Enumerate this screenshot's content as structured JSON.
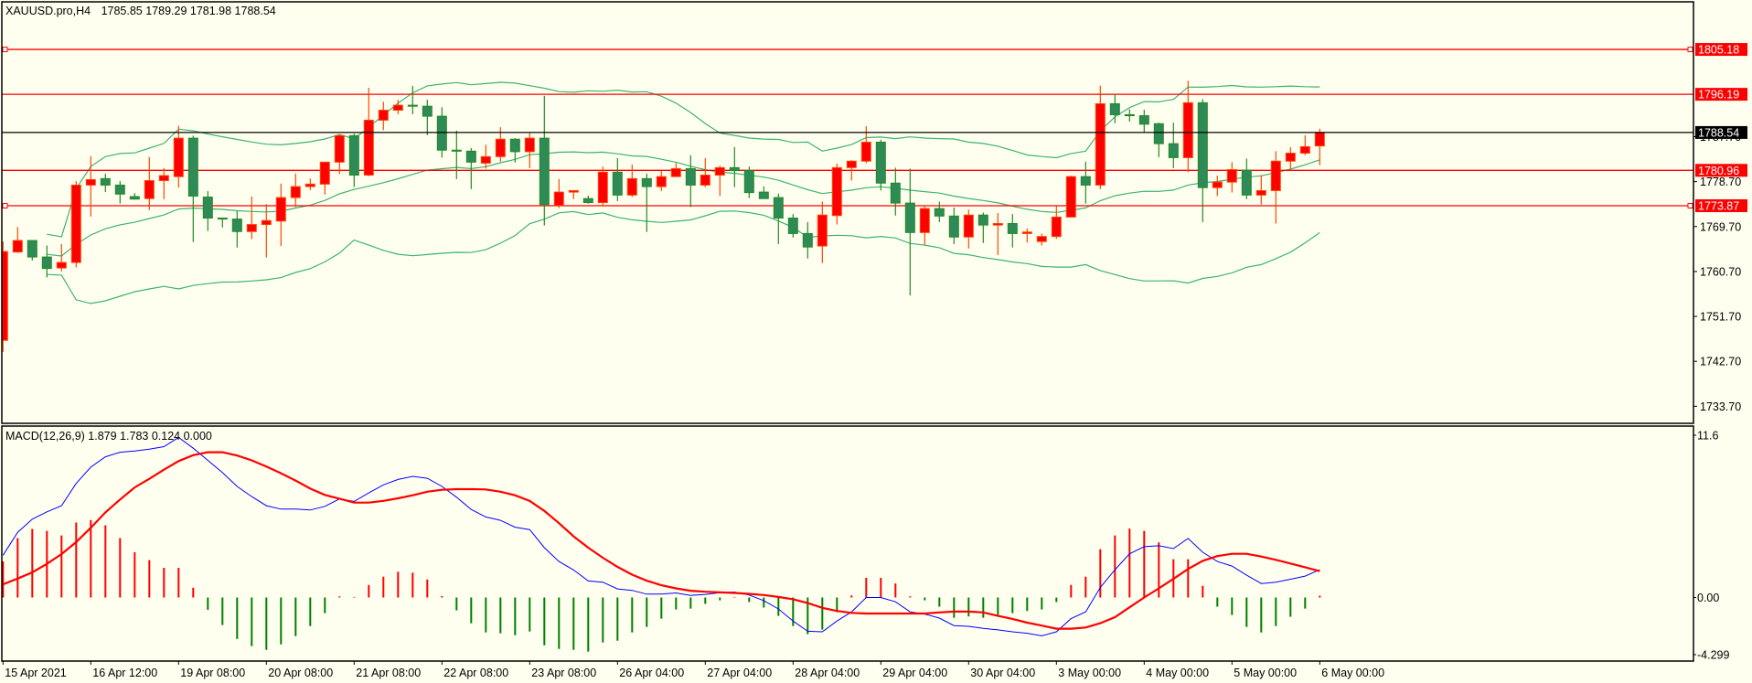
{
  "header": {
    "symbol_timeframe": "XAUUSD.pro,H4",
    "ohlc": "1785.85 1789.29 1781.98 1788.54"
  },
  "colors": {
    "background": "#fffff0",
    "bull": "#ff0000",
    "bull_border": "#ff4500",
    "bear": "#2e8b57",
    "bear_border": "#228b22",
    "bands": "#3cb371",
    "hline": "#ff0000",
    "bid": "#000000",
    "macd": "#0000ff",
    "signal": "#ff0000",
    "hist_up": "#ff0000",
    "hist_down": "#008000"
  },
  "price_axis": {
    "ticks": [
      "1787.70",
      "1778.70",
      "1769.70",
      "1760.70",
      "1751.70",
      "1742.70",
      "1733.70"
    ],
    "range": [
      1729.0,
      1810.0
    ]
  },
  "horizontal_lines": [
    {
      "label": "1805.18",
      "price": 1805.18,
      "marker": true
    },
    {
      "label": "1796.19",
      "price": 1796.19,
      "marker": false
    },
    {
      "label": "1780.96",
      "price": 1780.96,
      "marker": false
    },
    {
      "label": "1773.87",
      "price": 1773.87,
      "marker": true
    }
  ],
  "bid_line": {
    "label": "1788.54",
    "price": 1788.54
  },
  "macd": {
    "title": "MACD(12,26,9) 1.879 1.783 0.124 0.000",
    "axis_labels": {
      "max": "11.6",
      "zero": "0.00",
      "min": "-4.299"
    },
    "range": [
      -4.299,
      11.6
    ],
    "macd_line": [
      2.86,
      4.41,
      5.3,
      5.8,
      6.21,
      7.72,
      8.82,
      9.52,
      9.83,
      9.92,
      10.04,
      10.21,
      10.83,
      10.1,
      9.28,
      8.45,
      7.52,
      6.83,
      6.21,
      5.98,
      5.98,
      5.92,
      6.17,
      6.67,
      6.5,
      7.08,
      7.62,
      7.99,
      8.2,
      8.07,
      7.52,
      6.79,
      5.96,
      5.45,
      5.22,
      4.76,
      4.6,
      3.37,
      2.44,
      1.86,
      1.12,
      1.04,
      0.58,
      0.48,
      0.23,
      0.23,
      0.31,
      0.14,
      0.21,
      0.33,
      0.37,
      0.17,
      -0.21,
      -0.77,
      -1.59,
      -2.28,
      -2.32,
      -1.59,
      -0.97,
      0,
      0,
      -0.29,
      -0.97,
      -1.12,
      -1.39,
      -1.9,
      -1.95,
      -2.09,
      -2.19,
      -2.32,
      -2.42,
      -2.59,
      -2.32,
      -1.43,
      -0.97,
      0.68,
      1.88,
      2.96,
      3.44,
      3.5,
      3.31,
      4.0,
      3.06,
      2.44,
      2.13,
      1.51,
      0.95,
      1.04,
      1.24,
      1.45,
      1.879
    ],
    "signal_line": [
      0.89,
      1.28,
      1.7,
      2.28,
      2.94,
      3.75,
      4.72,
      5.76,
      6.63,
      7.45,
      8.03,
      8.65,
      9.23,
      9.63,
      9.83,
      9.83,
      9.61,
      9.28,
      8.86,
      8.41,
      7.91,
      7.37,
      6.94,
      6.69,
      6.42,
      6.42,
      6.54,
      6.71,
      6.92,
      7.16,
      7.29,
      7.33,
      7.33,
      7.31,
      7.16,
      6.92,
      6.54,
      5.86,
      5.03,
      4.14,
      3.37,
      2.69,
      2.07,
      1.55,
      1.14,
      0.83,
      0.62,
      0.46,
      0.39,
      0.35,
      0.31,
      0.25,
      0.17,
      0.04,
      -0.12,
      -0.37,
      -0.7,
      -0.91,
      -1.04,
      -1.08,
      -1.08,
      -1.08,
      -1.08,
      -1.08,
      -1.01,
      -0.95,
      -0.95,
      -1.01,
      -1.24,
      -1.45,
      -1.7,
      -1.9,
      -2.11,
      -2.11,
      -2.03,
      -1.74,
      -1.33,
      -0.66,
      0,
      0.62,
      1.26,
      1.93,
      2.48,
      2.8,
      2.96,
      2.96,
      2.77,
      2.55,
      2.3,
      2.05,
      1.783
    ],
    "histogram": [
      2.44,
      4.02,
      4.64,
      4.51,
      4.2,
      5.07,
      5.24,
      4.89,
      4.02,
      3.06,
      2.53,
      2.01,
      2.01,
      0.66,
      -0.83,
      -1.86,
      -2.8,
      -3.29,
      -3.54,
      -3.17,
      -2.61,
      -1.93,
      -1.06,
      0.08,
      0.04,
      0.85,
      1.41,
      1.74,
      1.68,
      1.22,
      0.1,
      -0.87,
      -1.74,
      -2.36,
      -2.42,
      -2.55,
      -2.3,
      -3.23,
      -3.48,
      -3.54,
      -3.66,
      -3.04,
      -2.92,
      -2.36,
      -1.99,
      -1.43,
      -0.81,
      -0.75,
      -0.43,
      -0.19,
      0.04,
      -0.31,
      -0.68,
      -1.24,
      -1.93,
      -2.48,
      -2.17,
      -0.99,
      0.14,
      1.33,
      1.33,
      0.95,
      0.08,
      -0.19,
      -0.62,
      -1.37,
      -1.28,
      -1.37,
      -1.18,
      -1.06,
      -0.91,
      -0.81,
      -0.31,
      0.85,
      1.41,
      3.27,
      4.2,
      4.66,
      4.51,
      3.73,
      2.59,
      2.59,
      0.79,
      -0.62,
      -1.18,
      -1.99,
      -2.36,
      -1.93,
      -1.3,
      -0.75,
      0.124
    ]
  },
  "time_axis": [
    {
      "label": "15 Apr 2021",
      "bar": 0
    },
    {
      "label": "16 Apr 12:00",
      "bar": 6
    },
    {
      "label": "19 Apr 08:00",
      "bar": 12
    },
    {
      "label": "20 Apr 08:00",
      "bar": 18
    },
    {
      "label": "21 Apr 08:00",
      "bar": 24
    },
    {
      "label": "22 Apr 08:00",
      "bar": 30
    },
    {
      "label": "23 Apr 08:00",
      "bar": 36
    },
    {
      "label": "26 Apr 04:00",
      "bar": 42
    },
    {
      "label": "27 Apr 04:00",
      "bar": 48
    },
    {
      "label": "28 Apr 04:00",
      "bar": 54
    },
    {
      "label": "29 Apr 04:00",
      "bar": 60
    },
    {
      "label": "30 Apr 04:00",
      "bar": 66
    },
    {
      "label": "3 May 00:00",
      "bar": 72
    },
    {
      "label": "4 May 00:00",
      "bar": 78
    },
    {
      "label": "5 May 00:00",
      "bar": 84
    },
    {
      "label": "6 May 00:00",
      "bar": 90
    }
  ],
  "bollinger": {
    "period": 20,
    "deviation": 2
  },
  "candles": [
    [
      1746.9,
      1766.7,
      1744.6,
      1764.7
    ],
    [
      1764.6,
      1769.6,
      1764.4,
      1766.9
    ],
    [
      1766.9,
      1767.0,
      1762.9,
      1763.6
    ],
    [
      1763.6,
      1765.9,
      1759.5,
      1761.3
    ],
    [
      1761.4,
      1766.2,
      1760.7,
      1762.5
    ],
    [
      1762.5,
      1778.8,
      1761.5,
      1778.0
    ],
    [
      1778.0,
      1783.8,
      1771.7,
      1779.1
    ],
    [
      1779.3,
      1780.3,
      1776.6,
      1778.0
    ],
    [
      1778.0,
      1778.8,
      1774.3,
      1776.2
    ],
    [
      1775.7,
      1776.4,
      1775.1,
      1775.2
    ],
    [
      1775.3,
      1783.6,
      1773.0,
      1778.9
    ],
    [
      1778.9,
      1781.4,
      1775.2,
      1779.9
    ],
    [
      1779.7,
      1789.9,
      1777.5,
      1787.4
    ],
    [
      1787.4,
      1787.9,
      1766.6,
      1775.8
    ],
    [
      1775.6,
      1776.8,
      1768.8,
      1771.4
    ],
    [
      1771.4,
      1771.4,
      1769.5,
      1771.2
    ],
    [
      1771.2,
      1772.8,
      1765.5,
      1768.7
    ],
    [
      1768.7,
      1775.7,
      1767.2,
      1770.1
    ],
    [
      1770.1,
      1774.2,
      1763.5,
      1770.9
    ],
    [
      1770.8,
      1778.3,
      1765.8,
      1775.5
    ],
    [
      1775.5,
      1780.3,
      1773.6,
      1777.7
    ],
    [
      1777.7,
      1779.3,
      1777.0,
      1778.2
    ],
    [
      1778.2,
      1782.6,
      1776.1,
      1782.6
    ],
    [
      1782.6,
      1788.2,
      1780.2,
      1787.9
    ],
    [
      1787.9,
      1788.3,
      1777.6,
      1780.0
    ],
    [
      1780.0,
      1797.5,
      1779.8,
      1791.0
    ],
    [
      1791.0,
      1794.7,
      1789.0,
      1793.0
    ],
    [
      1793.0,
      1795.1,
      1792.2,
      1794.0
    ],
    [
      1794.0,
      1797.9,
      1792.2,
      1793.8
    ],
    [
      1793.8,
      1795.1,
      1788.0,
      1791.8
    ],
    [
      1791.8,
      1793.6,
      1783.5,
      1785.0
    ],
    [
      1785.0,
      1788.9,
      1779.2,
      1784.8
    ],
    [
      1784.8,
      1785.4,
      1777.2,
      1782.6
    ],
    [
      1782.4,
      1786.1,
      1781.3,
      1783.7
    ],
    [
      1783.7,
      1789.6,
      1782.7,
      1787.2
    ],
    [
      1787.2,
      1787.4,
      1782.5,
      1784.7
    ],
    [
      1784.7,
      1788.4,
      1781.4,
      1787.4
    ],
    [
      1787.4,
      1795.9,
      1769.9,
      1774.1
    ],
    [
      1773.9,
      1779.2,
      1773.4,
      1776.6
    ],
    [
      1776.6,
      1776.9,
      1775.2,
      1776.9
    ],
    [
      1775.3,
      1775.9,
      1774.3,
      1774.5
    ],
    [
      1774.5,
      1781.7,
      1773.9,
      1780.6
    ],
    [
      1780.6,
      1783.4,
      1774.8,
      1776.0
    ],
    [
      1776.0,
      1782.1,
      1775.6,
      1779.3
    ],
    [
      1779.3,
      1780.3,
      1768.6,
      1777.7
    ],
    [
      1777.7,
      1780.8,
      1776.8,
      1779.7
    ],
    [
      1779.7,
      1782.4,
      1779.7,
      1781.3
    ],
    [
      1781.3,
      1784.0,
      1773.6,
      1778.0
    ],
    [
      1778.0,
      1783.4,
      1777.6,
      1780.0
    ],
    [
      1780.0,
      1781.9,
      1775.8,
      1781.5
    ],
    [
      1781.5,
      1785.6,
      1777.6,
      1780.9
    ],
    [
      1780.9,
      1781.7,
      1775.4,
      1776.5
    ],
    [
      1776.6,
      1777.7,
      1775.3,
      1775.3
    ],
    [
      1775.5,
      1776.3,
      1766.2,
      1771.4
    ],
    [
      1771.4,
      1772.2,
      1767.5,
      1768.3
    ],
    [
      1768.3,
      1770.6,
      1763.3,
      1765.6
    ],
    [
      1765.8,
      1774.7,
      1762.4,
      1772.0
    ],
    [
      1771.9,
      1782.3,
      1770.1,
      1781.5
    ],
    [
      1781.5,
      1783.0,
      1778.9,
      1782.8
    ],
    [
      1782.8,
      1789.8,
      1782.4,
      1786.6
    ],
    [
      1786.6,
      1787.1,
      1776.9,
      1778.4
    ],
    [
      1778.4,
      1781.5,
      1771.9,
      1774.4
    ],
    [
      1774.4,
      1781.3,
      1755.9,
      1768.5
    ],
    [
      1768.5,
      1774.0,
      1766.0,
      1773.3
    ],
    [
      1773.3,
      1774.7,
      1770.6,
      1771.8
    ],
    [
      1771.8,
      1773.5,
      1766.2,
      1767.6
    ],
    [
      1767.6,
      1773.1,
      1765.3,
      1772.0
    ],
    [
      1772.0,
      1772.5,
      1766.4,
      1770.0
    ],
    [
      1770.0,
      1772.4,
      1764.0,
      1770.3
    ],
    [
      1770.3,
      1772.2,
      1765.5,
      1768.3
    ],
    [
      1768.3,
      1769.3,
      1766.5,
      1768.6
    ],
    [
      1766.7,
      1768.3,
      1765.9,
      1767.7
    ],
    [
      1767.7,
      1773.8,
      1767.2,
      1771.6
    ],
    [
      1771.6,
      1779.9,
      1771.6,
      1779.7
    ],
    [
      1779.7,
      1782.7,
      1774.3,
      1778.0
    ],
    [
      1778.0,
      1797.9,
      1777.2,
      1794.3
    ],
    [
      1794.3,
      1796.2,
      1790.4,
      1792.1
    ],
    [
      1792.1,
      1793.2,
      1790.7,
      1791.9
    ],
    [
      1791.9,
      1793.1,
      1788.5,
      1790.2
    ],
    [
      1790.3,
      1790.5,
      1783.6,
      1786.3
    ],
    [
      1786.3,
      1790.5,
      1781.4,
      1783.5
    ],
    [
      1783.5,
      1798.9,
      1780.6,
      1794.5
    ],
    [
      1794.5,
      1795.2,
      1770.6,
      1777.5
    ],
    [
      1777.5,
      1779.9,
      1775.8,
      1778.6
    ],
    [
      1778.6,
      1782.6,
      1776.5,
      1781.1
    ],
    [
      1781.0,
      1783.3,
      1775.2,
      1776.0
    ],
    [
      1776.0,
      1780.0,
      1774.1,
      1776.9
    ],
    [
      1776.9,
      1784.8,
      1770.3,
      1782.8
    ],
    [
      1782.8,
      1785.6,
      1780.9,
      1784.4
    ],
    [
      1784.4,
      1788.0,
      1784.0,
      1785.7
    ],
    [
      1785.85,
      1789.29,
      1781.98,
      1788.54
    ]
  ]
}
